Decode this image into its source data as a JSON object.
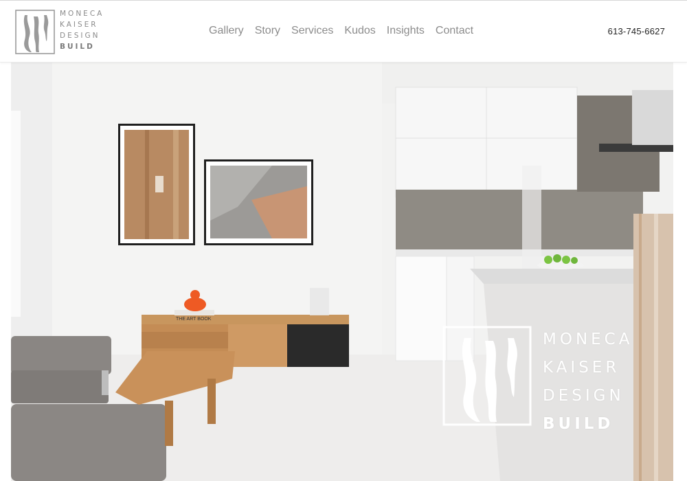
{
  "brand": {
    "words": [
      "MONECA",
      "KAISER",
      "DESIGN"
    ],
    "build_word": "BUILD"
  },
  "nav": {
    "items": [
      {
        "label": "Gallery"
      },
      {
        "label": "Story"
      },
      {
        "label": "Services"
      },
      {
        "label": "Kudos"
      },
      {
        "label": "Insights"
      },
      {
        "label": "Contact"
      }
    ]
  },
  "phone": "613-745-6627",
  "hero": {
    "book_title": "THE ART BOOK",
    "overlay_logo": {
      "words": [
        "MONECA",
        "KAISER",
        "DESIGN"
      ],
      "build_word": "BUILD"
    }
  },
  "colors": {
    "nav_text": "#8c8c8c",
    "logo_gray": "#8a8a8a",
    "phone_text": "#222222",
    "wood": "#c9a27a",
    "orange_accent": "#ee5a24",
    "backsplash": "#8f8b84"
  }
}
